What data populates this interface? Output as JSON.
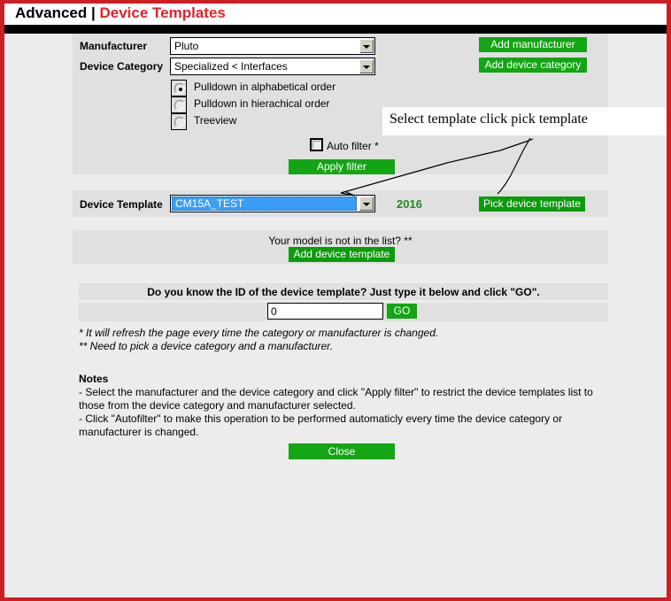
{
  "header": {
    "section": "Advanced",
    "separator": "|",
    "page": "Device Templates"
  },
  "colors": {
    "border_red": "#cc1f24",
    "title_red": "#e8202a",
    "button_green": "#13a513",
    "panel_gray": "#e0e0e0",
    "page_gray": "#ececec",
    "select_highlight": "#3b9ef5",
    "year_green": "#1f8b1f"
  },
  "filter_panel": {
    "manufacturer": {
      "label": "Manufacturer",
      "value": "Pluto",
      "dropdown_icon": "chevron-down-icon"
    },
    "device_category": {
      "label": "Device Category",
      "value": "Specialized < Interfaces",
      "dropdown_icon": "chevron-down-icon"
    },
    "display_mode": {
      "selected": "Pulldown in alphabetical order",
      "options": [
        "Pulldown in alphabetical order",
        "Pulldown in hierachical order",
        "Treeview"
      ]
    },
    "auto_filter": {
      "label": "Auto filter *",
      "checked": false
    },
    "apply_filter_label": "Apply filter",
    "add_manufacturer_label": "Add manufacturer",
    "add_device_category_label": "Add device category"
  },
  "template_panel": {
    "label": "Device Template",
    "value": "CM15A_TEST",
    "dropdown_icon": "chevron-down-icon",
    "year": "2016",
    "pick_button_label": "Pick device template"
  },
  "add_panel": {
    "prompt": "Your model is not in the list? **",
    "button_label": "Add device template"
  },
  "id_panel": {
    "prompt": "Do you know the ID of the device template? Just type it below and click \"GO\".",
    "input_value": "0",
    "go_label": "GO"
  },
  "footnotes": [
    "* It will refresh the page every time the category or manufacturer is changed.",
    "** Need to pick a device category and a manufacturer."
  ],
  "notes": {
    "heading": "Notes",
    "lines": [
      "- Select the manufacturer and the device category and click \"Apply filter\" to restrict the device templates list to those from the device category and manufacturer selected.",
      "- Click \"Autofilter\" to make this operation to be performed automaticly every time the device category or manufacturer is changed."
    ]
  },
  "close_button": {
    "label": "Close"
  },
  "annotation": {
    "text": "Select template click pick template"
  }
}
